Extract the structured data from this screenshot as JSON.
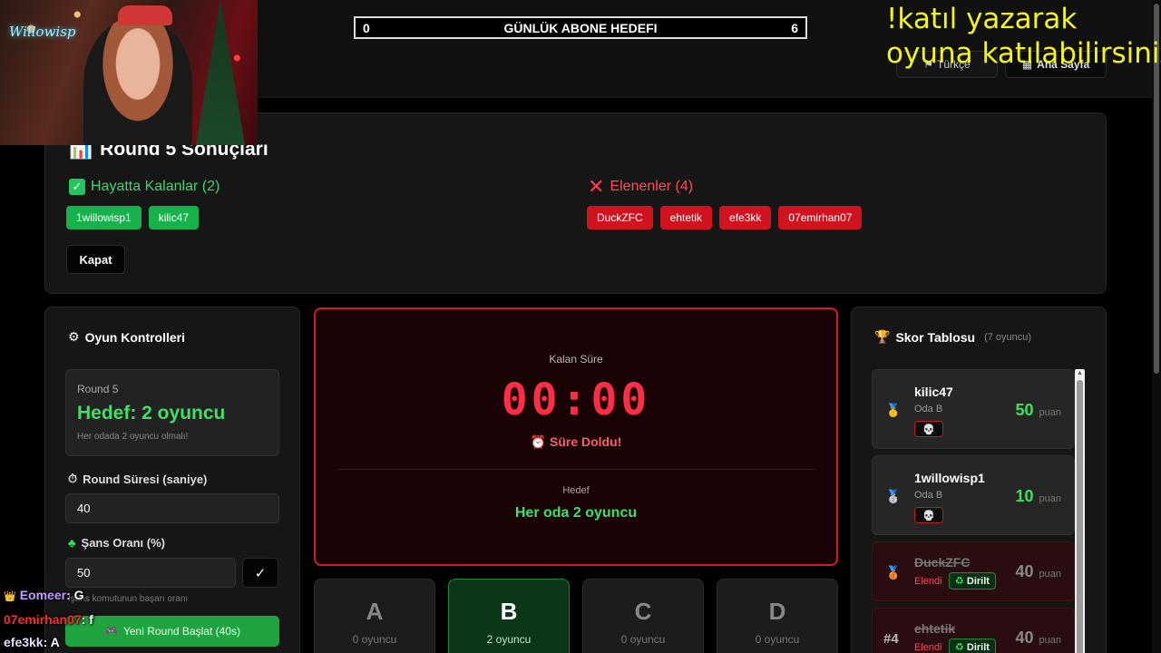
{
  "topbar": {
    "goal_left": "0",
    "goal_title": "GÜNLÜK ABONE HEDEFI",
    "goal_right": "6",
    "lang_flag": "⚑",
    "lang_label": "Türkçe",
    "home_icon": "▦",
    "home_label": "Ana Sayfa"
  },
  "overlay": {
    "line1": "!katıl yazarak",
    "line2": "oyuna katılabilirsiniz"
  },
  "webcam": {
    "neon_text": "Willowisp"
  },
  "results": {
    "title_icon": "📊",
    "title": "Round 5 Sonuçları",
    "alive_check": "✓",
    "alive_heading": "Hayatta Kalanlar (2)",
    "alive": [
      "1willowisp1",
      "kilic47"
    ],
    "out_mark": "✕",
    "out_heading": "Elenenler (4)",
    "out": [
      "DuckZFC",
      "ehtetik",
      "efe3kk",
      "07emirhan07"
    ],
    "close_label": "Kapat"
  },
  "controls": {
    "title_icon": "⚙",
    "title": "Oyun Kontrolleri",
    "round_label": "Round 5",
    "round_goal": "Hedef: 2 oyuncu",
    "round_note": "Her odada 2 oyuncu olmalı!",
    "duration_icon": "⏱",
    "duration_label": "Round Süresi (saniye)",
    "duration_value": "40",
    "luck_icon": "♣",
    "luck_label": "Şans Oranı (%)",
    "luck_value": "50",
    "ok_label": "✓",
    "hint": "!şans komutunun başarı oranı",
    "start_icon": "🎮",
    "start_label": "Yeni Round Başlat (40s)"
  },
  "timer": {
    "label": "Kalan Süre",
    "time": "00:00",
    "expired_icon": "⏰",
    "expired": "Süre Doldu!",
    "goal_label": "Hedef",
    "goal": "Her oda 2 oyuncu"
  },
  "rooms": [
    {
      "letter": "A",
      "count": "0 oyuncu"
    },
    {
      "letter": "B",
      "count": "2 oyuncu"
    },
    {
      "letter": "C",
      "count": "0 oyuncu"
    },
    {
      "letter": "D",
      "count": "0 oyuncu"
    }
  ],
  "scoreboard": {
    "title_icon": "🏆",
    "title": "Skor Tablosu",
    "count": "(7 oyuncu)",
    "unit": "puan",
    "items": [
      {
        "rank": "🥇",
        "name": "kilic47",
        "room": "Oda B",
        "points": "50",
        "skull": "💀"
      },
      {
        "rank": "🥈",
        "name": "1willowisp1",
        "room": "Oda B",
        "points": "10",
        "skull": "💀"
      },
      {
        "rank": "🥉",
        "name": "DuckZFC",
        "status": "Elendi",
        "revive": "Dirilt",
        "revive_icon": "♻",
        "points": "40"
      },
      {
        "rank": "#4",
        "name": "ehtetik",
        "status": "Elendi",
        "revive": "Dirilt",
        "revive_icon": "♻",
        "points": "40"
      }
    ]
  },
  "chat": [
    {
      "badge": "👑",
      "user": "Eomeer",
      "msg": ": G"
    },
    {
      "user": "07emirhan07",
      "msg": ": f"
    },
    {
      "user": "efe3kk",
      "msg": ": A"
    }
  ],
  "colors": {
    "accent_green": "#3fe066",
    "accent_red": "#ff2d46",
    "overlay_yellow": "#f4f41e"
  }
}
